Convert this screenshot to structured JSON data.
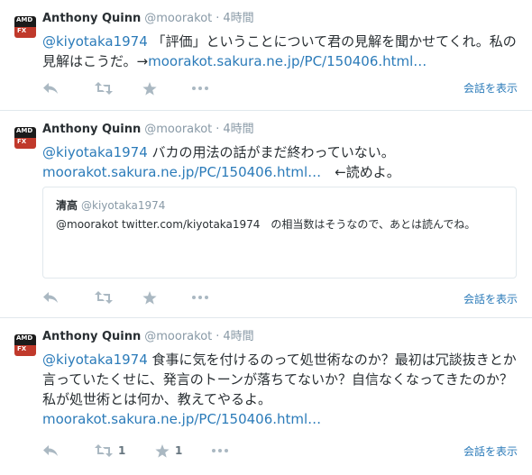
{
  "tweets": [
    {
      "avatar_text": "AMD",
      "avatar_fx": "FX",
      "name": "Anthony Quinn",
      "handle": "@moorakot",
      "dot": "·",
      "time": "4時間",
      "mention": "@kiyotaka1974",
      "body": " 「評価」ということについて君の見解を聞かせてくれ。私の見解はこうだ。→",
      "link": "moorakot.sakura.ne.jp/PC/150406.html…",
      "view_label": "会話を表示"
    },
    {
      "avatar_text": "AMD",
      "avatar_fx": "FX",
      "name": "Anthony Quinn",
      "handle": "@moorakot",
      "dot": "·",
      "time": "4時間",
      "mention": "@kiyotaka1974",
      "body": " バカの用法の話がまだ終わっていない。",
      "link": "moorakot.sakura.ne.jp/PC/150406.html…",
      "body_after": "　←読めよ。",
      "quote": {
        "name": "清高",
        "handle": "@kiyotaka1974",
        "text": "@moorakot twitter.com/kiyotaka1974　の相当数はそうなので、あとは読んでね。"
      },
      "view_label": "会話を表示"
    },
    {
      "avatar_text": "AMD",
      "avatar_fx": "FX",
      "name": "Anthony Quinn",
      "handle": "@moorakot",
      "dot": "·",
      "time": "4時間",
      "mention": "@kiyotaka1974",
      "body": " 食事に気を付けるのって処世術なのか？最初は冗談抜きとか言っていたくせに、発言のトーンが落ちてないか？自信なくなってきたのか？私が処世術とは何か、教えてやるよ。",
      "link": "moorakot.sakura.ne.jp/PC/150406.html…",
      "retweet_count": "1",
      "favorite_count": "1",
      "view_label": "会話を表示"
    }
  ],
  "icons": {
    "reply": "reply-icon",
    "retweet": "retweet-icon",
    "favorite": "star-icon",
    "more": "more-icon"
  },
  "colors": {
    "link": "#2b7bb9",
    "muted": "#8899a6",
    "divider": "#e1e8ed",
    "text": "#292f33"
  }
}
